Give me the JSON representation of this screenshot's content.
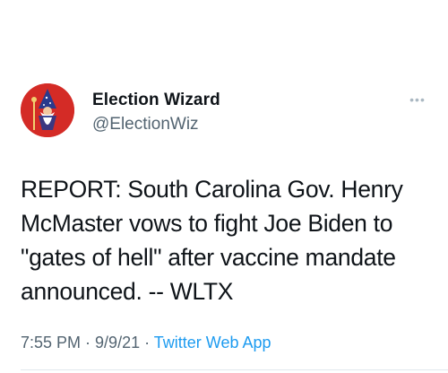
{
  "author": {
    "display_name": "Election Wizard",
    "handle": "@ElectionWiz",
    "avatar_icon": "wizard-gnome-avatar"
  },
  "more_icon": "ellipsis-icon",
  "more_glyph": "•••",
  "tweet": {
    "lines": [
      "REPORT: South Carolina Gov. Henry",
      "McMaster vows to fight Joe Biden to",
      "\"gates of hell\" after vaccine mandate",
      "announced. -- WLTX"
    ]
  },
  "meta": {
    "time": "7:55 PM",
    "sep1": " · ",
    "date": "9/9/21",
    "sep2": " · ",
    "source": "Twitter Web App"
  },
  "colors": {
    "text": "#0f1419",
    "muted": "#536471",
    "link": "#1d9bf0",
    "avatar_bg": "#d42b26"
  }
}
